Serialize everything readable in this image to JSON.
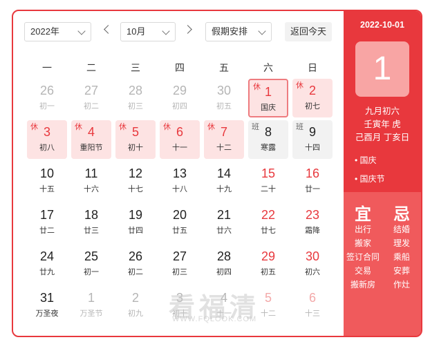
{
  "toolbar": {
    "year": "2022年",
    "month": "10月",
    "holiday_select": "假期安排",
    "today_button": "返回今天"
  },
  "weekdays": [
    "一",
    "二",
    "三",
    "四",
    "五",
    "六",
    "日"
  ],
  "days": [
    {
      "num": "26",
      "lunar": "初一",
      "state": "off"
    },
    {
      "num": "27",
      "lunar": "初二",
      "state": "off"
    },
    {
      "num": "28",
      "lunar": "初三",
      "state": "off"
    },
    {
      "num": "29",
      "lunar": "初四",
      "state": "off"
    },
    {
      "num": "30",
      "lunar": "初五",
      "state": "off"
    },
    {
      "num": "1",
      "lunar": "国庆",
      "state": "holiday",
      "tag": "休",
      "selected": true
    },
    {
      "num": "2",
      "lunar": "初七",
      "state": "holiday",
      "tag": "休"
    },
    {
      "num": "3",
      "lunar": "初八",
      "state": "holiday",
      "tag": "休"
    },
    {
      "num": "4",
      "lunar": "重阳节",
      "state": "holiday",
      "tag": "休"
    },
    {
      "num": "5",
      "lunar": "初十",
      "state": "holiday",
      "tag": "休"
    },
    {
      "num": "6",
      "lunar": "十一",
      "state": "holiday",
      "tag": "休"
    },
    {
      "num": "7",
      "lunar": "十二",
      "state": "holiday",
      "tag": "休"
    },
    {
      "num": "8",
      "lunar": "寒露",
      "state": "work",
      "tag": "班"
    },
    {
      "num": "9",
      "lunar": "十四",
      "state": "work",
      "tag": "班"
    },
    {
      "num": "10",
      "lunar": "十五",
      "state": "normal"
    },
    {
      "num": "11",
      "lunar": "十六",
      "state": "normal"
    },
    {
      "num": "12",
      "lunar": "十七",
      "state": "normal"
    },
    {
      "num": "13",
      "lunar": "十八",
      "state": "normal"
    },
    {
      "num": "14",
      "lunar": "十九",
      "state": "normal"
    },
    {
      "num": "15",
      "lunar": "二十",
      "state": "red"
    },
    {
      "num": "16",
      "lunar": "廿一",
      "state": "red"
    },
    {
      "num": "17",
      "lunar": "廿二",
      "state": "normal"
    },
    {
      "num": "18",
      "lunar": "廿三",
      "state": "normal"
    },
    {
      "num": "19",
      "lunar": "廿四",
      "state": "normal"
    },
    {
      "num": "20",
      "lunar": "廿五",
      "state": "normal"
    },
    {
      "num": "21",
      "lunar": "廿六",
      "state": "normal"
    },
    {
      "num": "22",
      "lunar": "廿七",
      "state": "red"
    },
    {
      "num": "23",
      "lunar": "霜降",
      "state": "red"
    },
    {
      "num": "24",
      "lunar": "廿九",
      "state": "normal"
    },
    {
      "num": "25",
      "lunar": "初一",
      "state": "normal"
    },
    {
      "num": "26",
      "lunar": "初二",
      "state": "normal"
    },
    {
      "num": "27",
      "lunar": "初三",
      "state": "normal"
    },
    {
      "num": "28",
      "lunar": "初四",
      "state": "normal"
    },
    {
      "num": "29",
      "lunar": "初五",
      "state": "red"
    },
    {
      "num": "30",
      "lunar": "初六",
      "state": "red"
    },
    {
      "num": "31",
      "lunar": "万圣夜",
      "state": "normal"
    },
    {
      "num": "1",
      "lunar": "万圣节",
      "state": "off"
    },
    {
      "num": "2",
      "lunar": "初九",
      "state": "off"
    },
    {
      "num": "3",
      "lunar": "初十",
      "state": "off"
    },
    {
      "num": "4",
      "lunar": "十一",
      "state": "off"
    },
    {
      "num": "5",
      "lunar": "十二",
      "state": "off",
      "weekend": true
    },
    {
      "num": "6",
      "lunar": "十三",
      "state": "off",
      "weekend": true
    }
  ],
  "panel": {
    "date": "2022-10-01",
    "day": "1",
    "lunar_date": "九月初六",
    "ganzhi_year": "壬寅年 虎",
    "ganzhi_month_day": "己酉月 丁亥日",
    "festivals": [
      "• 国庆",
      "• 国庆节"
    ],
    "yi_label": "宜",
    "ji_label": "忌",
    "yi": [
      "出行",
      "搬家",
      "签订合同",
      "交易",
      "搬新房"
    ],
    "ji": [
      "结婚",
      "理发",
      "乘船",
      "安葬",
      "作灶"
    ]
  },
  "watermark": {
    "text": "看福清",
    "url": "WWW.FQLOOK.COM"
  },
  "colors": {
    "accent": "#e8383d",
    "holiday_bg": "#fde3e3",
    "panel_bottom": "#f05a5c"
  }
}
